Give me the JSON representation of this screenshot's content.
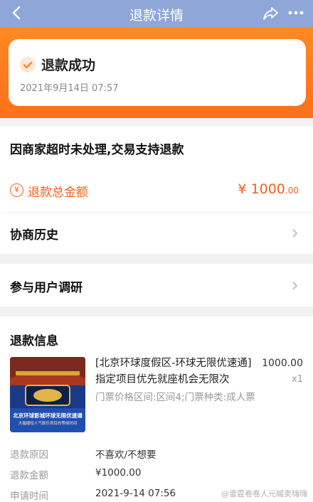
{
  "header": {
    "title": "退款详情",
    "back_icon": "back-arrow-icon",
    "share_icon": "share-icon",
    "more_icon": "more-icon"
  },
  "status": {
    "title": "退款成功",
    "time": "2021年9月14日 07:57",
    "icon": "check-icon"
  },
  "reason": "因商家超时未处理,交易支持退款",
  "refund_total": {
    "label": "退款总金额",
    "currency": "¥",
    "amount_int": "1000",
    "amount_dec": ".00",
    "icon": "yen-icon"
  },
  "rows": [
    {
      "label": "协商历史"
    },
    {
      "label": "参与用户调研"
    }
  ],
  "refund_info": {
    "title": "退款信息",
    "product": {
      "name": "[北京环球度假区-环球无限优速通]指定项目优先就座机会无限次",
      "spec": "门票价格区间:区间4;门票种类:成人票",
      "price": "1000.00",
      "qty": "x1",
      "image_text": "北京环球影城环球无限优速通",
      "image_subtext": "大幅缩短人气娱乐项目的等候时间"
    },
    "details": [
      {
        "label": "退款原因",
        "value": "不喜欢/不想要"
      },
      {
        "label": "退款金额",
        "value": "¥1000.00"
      },
      {
        "label": "申请时间",
        "value": "2021-9-14 07:56"
      }
    ]
  },
  "watermark": "@雷霆卷卷人元嘁卖嗨嗨",
  "colors": {
    "navbar": "#8fa6d8",
    "accent_orange": "#f0601e",
    "banner": "#ff7a1e"
  }
}
